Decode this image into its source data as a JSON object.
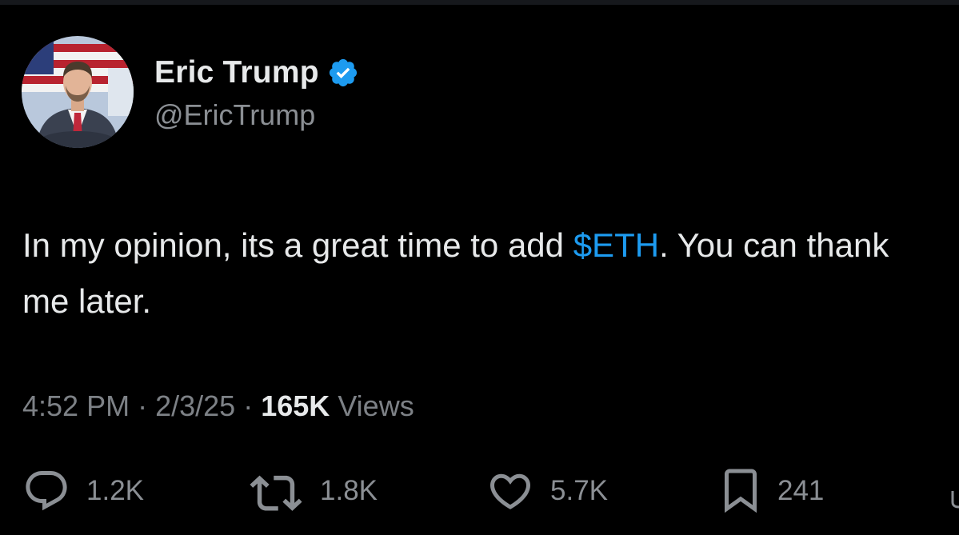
{
  "author": {
    "display_name": "Eric Trump",
    "handle": "@EricTrump",
    "verified": true,
    "verified_icon": "verified-badge-icon"
  },
  "tweet": {
    "text_before": "In my opinion, its a great time to add ",
    "cashtag": "$ETH",
    "text_after": ". You can thank me later."
  },
  "meta": {
    "time": "4:52 PM",
    "separator": "·",
    "date": "2/3/25",
    "views_count": "165K",
    "views_label": "Views"
  },
  "actions": {
    "replies": "1.2K",
    "reposts": "1.8K",
    "likes": "5.7K",
    "bookmarks": "241"
  },
  "colors": {
    "background": "#000000",
    "text_primary": "#e7e9ea",
    "text_secondary": "#8b8f94",
    "accent": "#1d9bf0"
  }
}
